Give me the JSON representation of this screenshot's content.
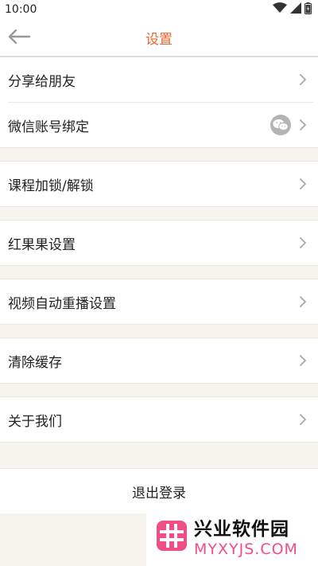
{
  "status_bar": {
    "time": "10:00"
  },
  "header": {
    "title": "设置"
  },
  "groups": [
    {
      "items": [
        {
          "label": "分享给朋友"
        },
        {
          "label": "微信账号绑定",
          "badge_icon": "wechat-icon"
        }
      ]
    },
    {
      "items": [
        {
          "label": "课程加锁/解锁"
        }
      ]
    },
    {
      "items": [
        {
          "label": "红果果设置"
        }
      ]
    },
    {
      "items": [
        {
          "label": "视频自动重播设置"
        }
      ]
    },
    {
      "items": [
        {
          "label": "清除缓存"
        }
      ]
    },
    {
      "items": [
        {
          "label": "关于我们"
        }
      ]
    }
  ],
  "logout": {
    "label": "退出登录"
  },
  "watermark": {
    "cn": "兴业软件园",
    "en": "MYXYJS.COM"
  },
  "colors": {
    "title": "#e8642c",
    "background": "#f6f4ec",
    "watermark_accent": "#f24d86"
  }
}
